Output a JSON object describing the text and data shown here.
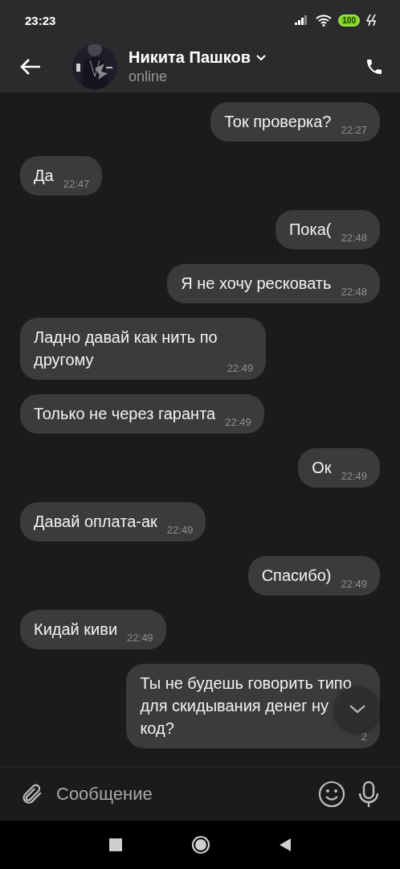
{
  "status_bar": {
    "time": "23:23",
    "battery": "100"
  },
  "header": {
    "name": "Никита Пашков",
    "status": "online"
  },
  "messages": [
    {
      "text": "Ток проверка?",
      "time": "22:27",
      "out": true
    },
    {
      "text": "Да",
      "time": "22:47",
      "out": false
    },
    {
      "text": "Пока(",
      "time": "22:48",
      "out": true
    },
    {
      "text": "Я не хочу ресковать",
      "time": "22:48",
      "out": true
    },
    {
      "text": "Ладно давай как нить по\nдругому",
      "time": "22:49",
      "out": false
    },
    {
      "text": "Только не через гаранта",
      "time": "22:49",
      "out": false
    },
    {
      "text": "Ок",
      "time": "22:49",
      "out": true
    },
    {
      "text": "Давай оплата-ак",
      "time": "22:49",
      "out": false
    },
    {
      "text": "Спасибо)",
      "time": "22:49",
      "out": true
    },
    {
      "text": "Кидай киви",
      "time": "22:49",
      "out": false
    },
    {
      "text": "Ты не будешь говорить типо\nдля скидывания денег ну\nкод?",
      "time": "2",
      "out": true
    }
  ],
  "composer": {
    "placeholder": "Сообщение"
  }
}
